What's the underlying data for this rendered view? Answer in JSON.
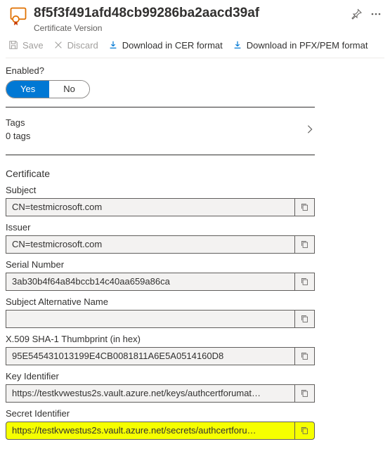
{
  "header": {
    "title": "8f5f3f491afd48cb99286ba2aacd39af",
    "subtitle": "Certificate Version"
  },
  "toolbar": {
    "save": "Save",
    "discard": "Discard",
    "download_cer": "Download in CER format",
    "download_pfx": "Download in PFX/PEM format"
  },
  "enabled": {
    "label": "Enabled?",
    "yes": "Yes",
    "no": "No"
  },
  "tags": {
    "title": "Tags",
    "count": "0 tags"
  },
  "certificate": {
    "heading": "Certificate",
    "subject_label": "Subject",
    "subject_value": "CN=testmicrosoft.com",
    "issuer_label": "Issuer",
    "issuer_value": "CN=testmicrosoft.com",
    "serial_label": "Serial Number",
    "serial_value": "3ab30b4f64a84bccb14c40aa659a86ca",
    "san_label": "Subject Alternative Name",
    "san_value": "",
    "thumb_label": "X.509 SHA-1 Thumbprint (in hex)",
    "thumb_value": "95E545431013199E4CB0081811A6E5A0514160D8",
    "keyid_label": "Key Identifier",
    "keyid_value": "https://testkvwestus2s.vault.azure.net/keys/authcertforumat…",
    "secretid_label": "Secret Identifier",
    "secretid_value": "https://testkvwestus2s.vault.azure.net/secrets/authcertforu…"
  }
}
